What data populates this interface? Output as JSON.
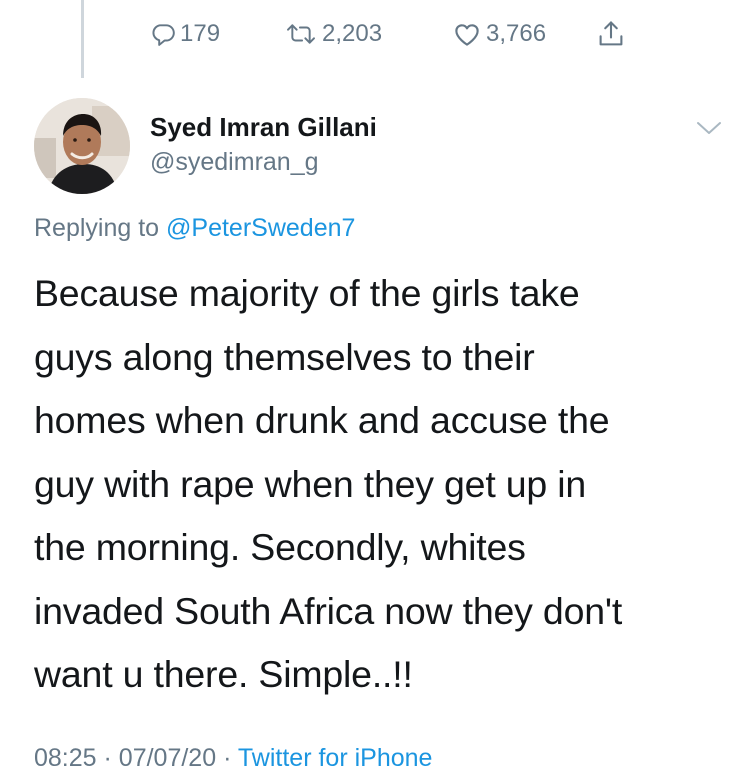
{
  "actions": {
    "reply": {
      "icon": "reply-icon",
      "count": "179"
    },
    "retweet": {
      "icon": "retweet-icon",
      "count": "2,203"
    },
    "like": {
      "icon": "heart-icon",
      "count": "3,766"
    },
    "share": {
      "icon": "share-icon"
    }
  },
  "tweet": {
    "author_name": "Syed Imran Gillani",
    "author_handle": "@syedimran_g",
    "replying_prefix": "Replying to",
    "replying_to": "@PeterSweden7",
    "text_lines": [
      "Because majority of the girls take",
      "guys along themselves to their",
      "homes when drunk and accuse the",
      "guy with rape when they get up in",
      "the morning. Secondly, whites",
      "invaded South Africa now they don't",
      "want u there. Simple..!!"
    ],
    "time": "08:25",
    "date": "07/07/20",
    "separator": "·",
    "source": "Twitter for iPhone"
  },
  "colors": {
    "text": "#14171a",
    "secondary": "#657786",
    "link": "#1b95e0",
    "thread_line": "#cfd6dc"
  }
}
